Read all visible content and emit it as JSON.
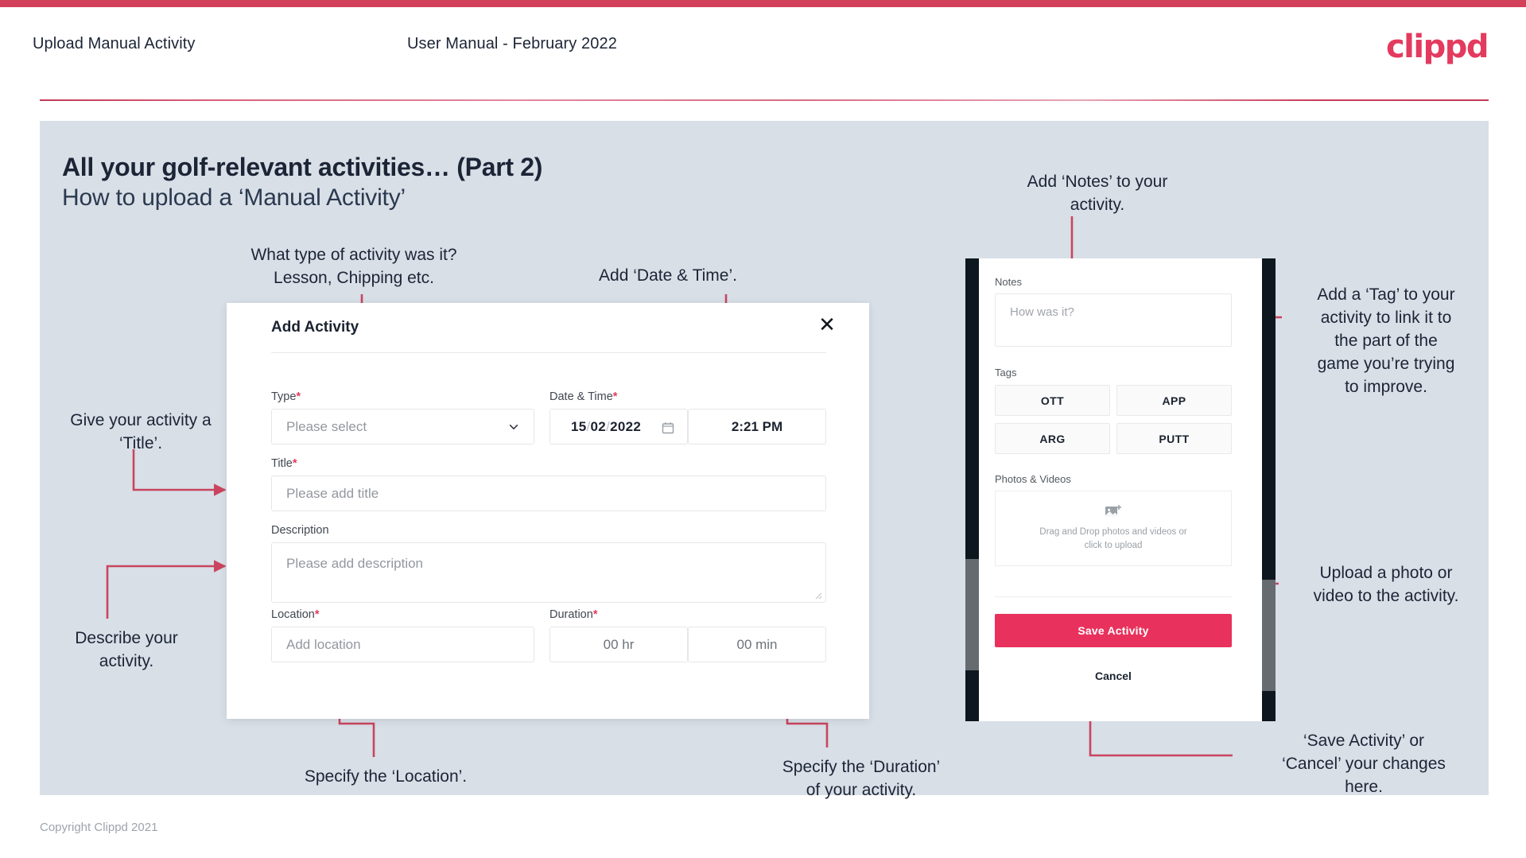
{
  "header": {
    "left_title": "Upload Manual Activity",
    "center_title": "User Manual - February 2022",
    "brand": "clippd"
  },
  "slide": {
    "title": "All your golf-relevant activities… (Part 2)",
    "subtitle": "How to upload a ‘Manual Activity’"
  },
  "annotations": {
    "type": "What type of activity was it?\nLesson, Chipping etc.",
    "datetime": "Add ‘Date & Time’.",
    "notes": "Add ‘Notes’ to your\nactivity.",
    "tag": "Add a ‘Tag’ to your\nactivity to link it to\nthe part of the\ngame you’re trying\nto improve.",
    "title_field": "Give your activity a\n‘Title’.",
    "description": "Describe your\nactivity.",
    "location": "Specify the ‘Location’.",
    "duration": "Specify the ‘Duration’\nof your activity.",
    "upload": "Upload a photo or\nvideo to the activity.",
    "save_cancel": "‘Save Activity’ or\n‘Cancel’ your changes\nhere."
  },
  "dialog": {
    "title": "Add Activity",
    "close_icon": "close-icon",
    "type": {
      "label": "Type",
      "required": "*",
      "placeholder": "Please select"
    },
    "datetime": {
      "label": "Date & Time",
      "required": "*",
      "day": "15",
      "sep1": "/",
      "month": "02",
      "sep2": "/",
      "year": "2022",
      "time": "2:21 PM"
    },
    "title_field": {
      "label": "Title",
      "required": "*",
      "placeholder": "Please add title"
    },
    "description": {
      "label": "Description",
      "placeholder": "Please add description"
    },
    "location": {
      "label": "Location",
      "required": "*",
      "placeholder": "Add location"
    },
    "duration": {
      "label": "Duration",
      "required": "*",
      "hours": "00 hr",
      "minutes": "00 min"
    }
  },
  "mobile": {
    "notes": {
      "label": "Notes",
      "placeholder": "How was it?"
    },
    "tags": {
      "label": "Tags",
      "items": [
        "OTT",
        "APP",
        "ARG",
        "PUTT"
      ]
    },
    "photos": {
      "label": "Photos & Videos",
      "drop_text": "Drag and Drop photos and videos or\nclick to upload"
    },
    "save_label": "Save Activity",
    "cancel_label": "Cancel"
  },
  "footer": {
    "copyright": "Copyright Clippd 2021"
  },
  "colors": {
    "accent": "#e33a5d",
    "save_button": "#e8315c",
    "slide_bg": "#d8dfe7",
    "text": "#1c2536",
    "connector": "#c9455f"
  }
}
